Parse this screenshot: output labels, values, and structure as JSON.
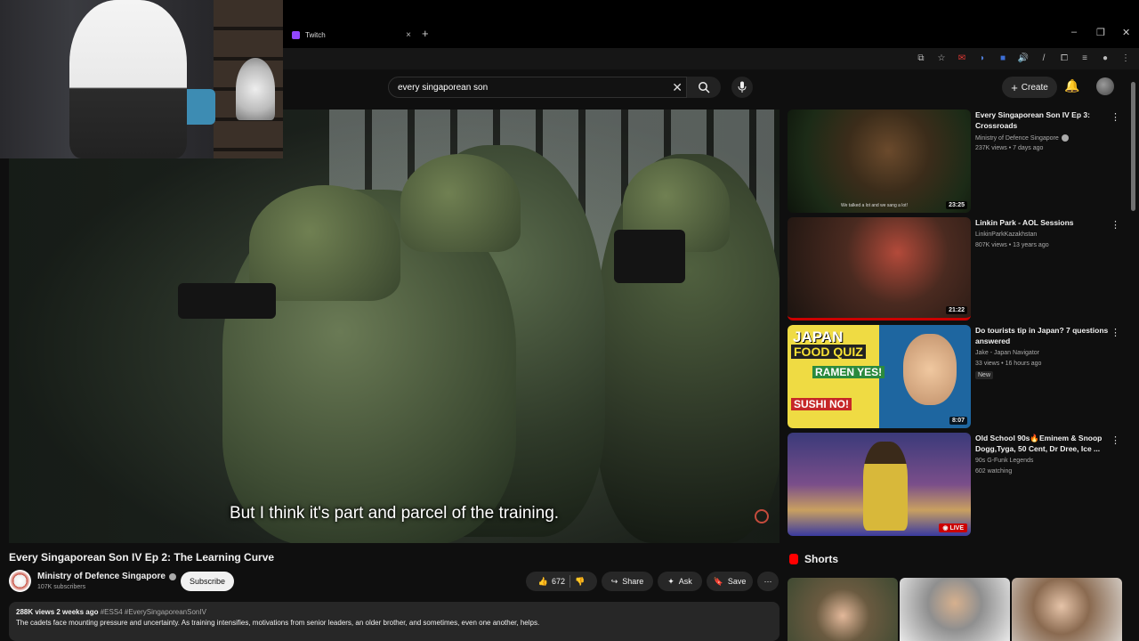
{
  "browser": {
    "tab_title": "Twitch",
    "new_tab": "+",
    "tab_close": "×"
  },
  "search": {
    "value": "every singaporean son"
  },
  "header": {
    "create_label": "Create"
  },
  "video": {
    "subtitle": "But I think it's part and parcel of the training.",
    "title": "Every Singaporean Son IV Ep 2: The Learning Curve",
    "channel": "Ministry of Defence Singapore",
    "subscribers": "107K subscribers",
    "subscribe_label": "Subscribe",
    "likes": "672",
    "share_label": "Share",
    "ask_label": "Ask",
    "save_label": "Save",
    "views_date": "288K views  2 weeks ago",
    "hashtags": "#ESS4 #EverySingaporeanSonIV",
    "description": "The cadets face mounting pressure and uncertainty. As training intensifies, motivations from senior leaders, an older brother, and sometimes, even one another, helps."
  },
  "recommendations": [
    {
      "title": "Every Singaporean Son IV Ep 3: Crossroads",
      "channel": "Ministry of Defence Singapore",
      "verified": true,
      "meta": "237K views • 7 days ago",
      "duration": "23:25",
      "thumb_caption": "We talked a lot and we sang a lot!"
    },
    {
      "title": "Linkin Park - AOL Sessions",
      "channel": "LinkinParkKazakhstan",
      "meta": "807K views • 13 years ago",
      "duration": "21:22"
    },
    {
      "title": "Do tourists tip in Japan? 7 questions answered",
      "channel": "Jake - Japan Navigator",
      "meta": "33 views • 16 hours ago",
      "badge": "New",
      "duration": "8:07",
      "thumb_text": [
        "JAPAN",
        "FOOD QUIZ",
        "RAMEN YES!",
        "SUSHI NO!"
      ]
    },
    {
      "title": "Old School 90s🔥Eminem & Snoop Dogg,Tyga, 50 Cent, Dr Dree, Ice ...",
      "channel": "90s G-Funk Legends",
      "meta": "602 watching",
      "live_label": "LIVE"
    }
  ],
  "shorts": {
    "heading": "Shorts"
  },
  "colors": {
    "background": "#0f0f0f",
    "surface": "#272727",
    "accent_red": "#ff0000",
    "twitch_purple": "#9146ff"
  }
}
